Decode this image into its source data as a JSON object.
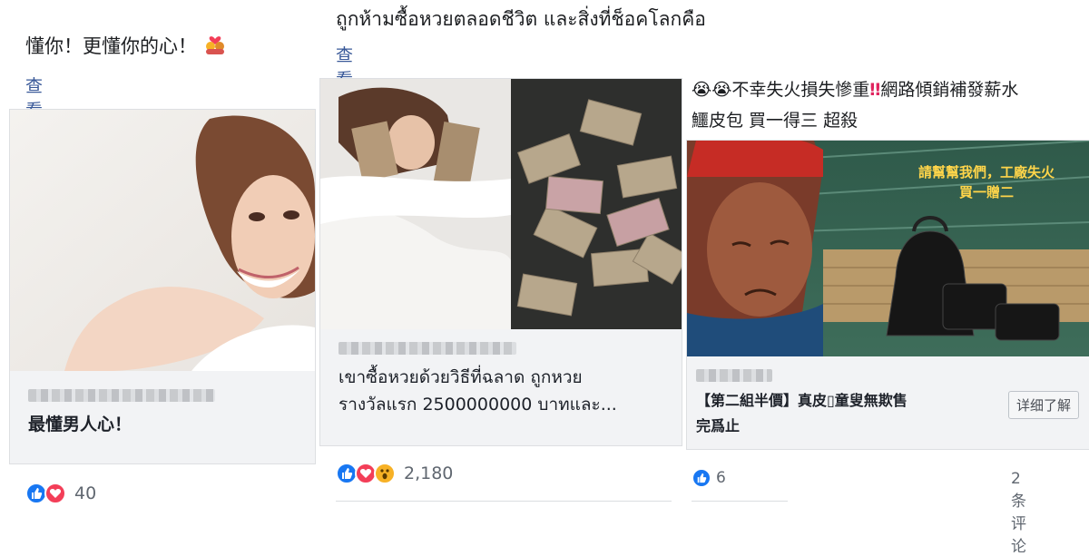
{
  "posts": [
    {
      "caption": "懂你！更懂你的心！",
      "caption_emoji": "couple-with-heart",
      "translate": "查看翻译",
      "card_domain": "",
      "card_title": "最懂男人心！",
      "reaction_count": "40"
    },
    {
      "caption": "ถูกห้ามซื้อหวยตลอดชีวิต และสิ่งที่ช็อคโลกคือ",
      "translate": "查看翻译",
      "card_domain": "",
      "card_title_line1": "เขาซื้อหวยด้วยวิธีที่ฉลาด ถูกหวย",
      "card_title_line2": "รางวัลแรก 2500000000 บาทและ...",
      "reaction_count": "2,180"
    },
    {
      "caption_emojis": "😭😭",
      "caption_line1": "不幸失火損失慘重",
      "caption_mark": "‼",
      "caption_line1b": "網路傾銷補發薪水",
      "caption_line2": "鱷皮包 買一得三 超殺",
      "image_text_line1": "請幫幫我們，工廠失火",
      "image_text_line2": "買一贈二",
      "card_domain": "",
      "card_title_line1": "【第二組半價】真皮▯童叟無欺售",
      "card_title_line2": "完爲止",
      "detail_button": "详细了解",
      "reaction_count": "6",
      "comments": "2 条评论"
    }
  ],
  "colors": {
    "like": "#1877f2",
    "love": "#f33e58",
    "wow": "#f7b125",
    "link": "#385898"
  }
}
